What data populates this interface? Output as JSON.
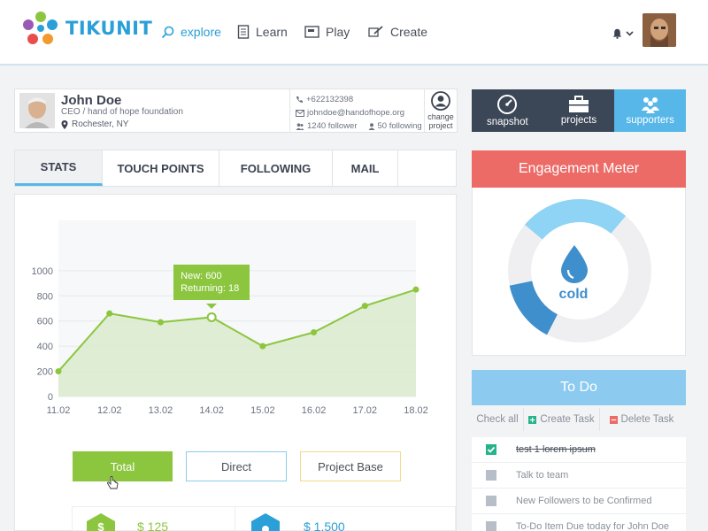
{
  "brand": {
    "name": "TIKUNIT"
  },
  "nav": [
    {
      "label": "explore",
      "icon": "search-icon"
    },
    {
      "label": "Learn",
      "icon": "book-icon"
    },
    {
      "label": "Play",
      "icon": "play-window-icon"
    },
    {
      "label": "Create",
      "icon": "pencil-icon"
    }
  ],
  "profile": {
    "name": "John Doe",
    "role": "CEO / hand of hope foundation",
    "location": "Rochester, NY",
    "phone": "+622132398",
    "email": "johndoe@handofhope.org",
    "followers": "1240 follower",
    "following": "50 following",
    "change_label_1": "change",
    "change_label_2": "project"
  },
  "right_tabs": [
    {
      "label": "snapshot",
      "icon": "gauge-icon"
    },
    {
      "label": "projects",
      "icon": "briefcase-icon"
    },
    {
      "label": "supporters",
      "icon": "people-icon"
    }
  ],
  "stat_tabs": [
    "STATS",
    "TOUCH POINTS",
    "FOLLOWING",
    "MAIL"
  ],
  "tooltip": {
    "line1": "New: 600",
    "line2": "Returning: 18"
  },
  "chart_data": {
    "type": "area",
    "categories": [
      "11.02",
      "12.02",
      "13.02",
      "14.02",
      "15.02",
      "16.02",
      "17.02",
      "18.02"
    ],
    "values": [
      200,
      660,
      590,
      630,
      400,
      510,
      720,
      850
    ],
    "yticks": [
      0,
      200,
      400,
      600,
      800,
      1000
    ],
    "ylim": [
      0,
      1400
    ],
    "grid": true,
    "color": "#8cc63f"
  },
  "filter_buttons": {
    "total": "Total",
    "direct": "Direct",
    "project_base": "Project Base"
  },
  "money": {
    "a": "$ 125",
    "b": "$ 1.500"
  },
  "engagement": {
    "title": "Engagement Meter",
    "state": "cold"
  },
  "todo": {
    "title": "To Do",
    "check_all": "Check all",
    "create": "Create Task",
    "delete": "Delete Task",
    "items": [
      {
        "label": "test 1 lorem ipsum",
        "done": true
      },
      {
        "label": "Talk to team",
        "done": false
      },
      {
        "label": "New Followers to be Confirmed",
        "done": false
      },
      {
        "label": "To-Do Item Due today for John Doe",
        "done": false
      }
    ]
  },
  "colors": {
    "accent": "#2a9fd8",
    "dark": "#3b4656",
    "red": "#ec6b67",
    "green": "#8cc63f",
    "lightblue": "#8ccbef"
  }
}
